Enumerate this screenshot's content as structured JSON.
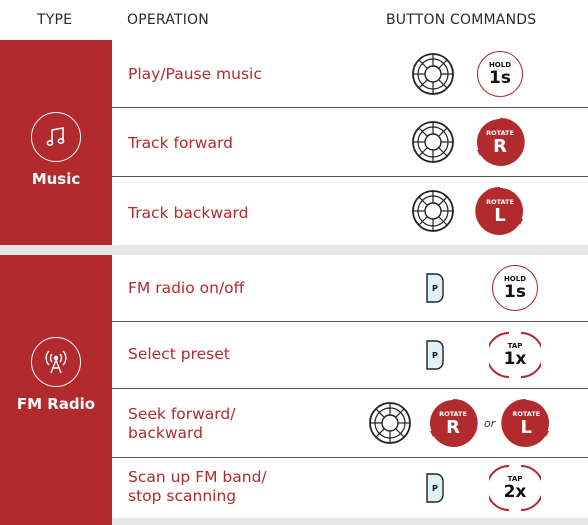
{
  "header": {
    "type": "TYPE",
    "operation": "OPERATION",
    "commands": "BUTTON COMMANDS"
  },
  "colors": {
    "accent": "#b22a2e",
    "band": "#e6e6e6"
  },
  "sections": [
    {
      "type_label": "Music",
      "icon": "music-note-icon",
      "rows": [
        {
          "operation": "Play/Pause music",
          "dial_badge": "HOLD",
          "dial_value": "1s"
        },
        {
          "operation": "Track forward",
          "rotate_label": "ROTATE",
          "rotate_value": "R"
        },
        {
          "operation": "Track backward",
          "rotate_label": "ROTATE",
          "rotate_value": "L"
        }
      ]
    },
    {
      "type_label": "FM Radio",
      "icon": "radio-tower-icon",
      "rows": [
        {
          "operation": "FM radio on/off",
          "button": "P",
          "badge_label": "HOLD",
          "badge_value": "1s"
        },
        {
          "operation": "Select preset",
          "button": "P",
          "badge_label": "TAP",
          "badge_value": "1x"
        },
        {
          "operation_line1": "Seek forward/",
          "operation_line2": "backward",
          "rotate_label": "ROTATE",
          "rotate_r": "R",
          "or_text": "or",
          "rotate_l": "L"
        },
        {
          "operation_line1": "Scan up FM band/",
          "operation_line2": "stop scanning",
          "button": "P",
          "badge_label": "TAP",
          "badge_value": "2x"
        }
      ]
    }
  ]
}
